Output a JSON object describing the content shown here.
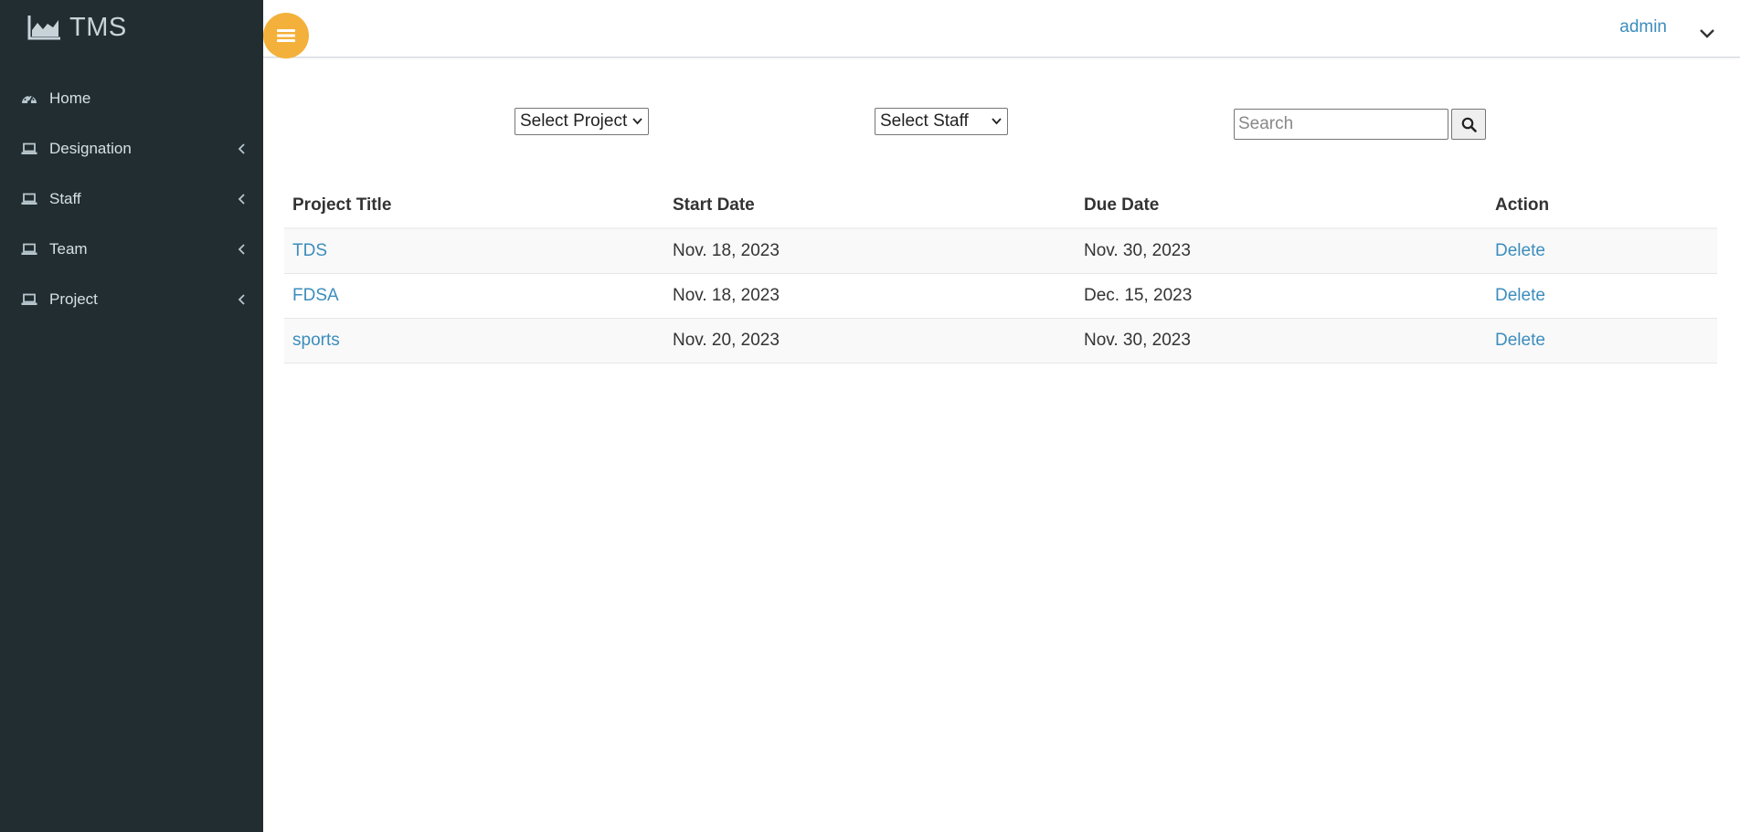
{
  "app": {
    "brand": "TMS"
  },
  "sidebar": {
    "items": [
      {
        "label": "Home",
        "icon": "dashboard-icon",
        "has_submenu": false
      },
      {
        "label": "Designation",
        "icon": "laptop-icon",
        "has_submenu": true
      },
      {
        "label": "Staff",
        "icon": "laptop-icon",
        "has_submenu": true
      },
      {
        "label": "Team",
        "icon": "laptop-icon",
        "has_submenu": true
      },
      {
        "label": "Project",
        "icon": "laptop-icon",
        "has_submenu": true
      }
    ]
  },
  "header": {
    "user": "admin",
    "toggle_icon": "bars-icon",
    "toggle_color": "#f3b13b"
  },
  "filters": {
    "project_select": "Select Project",
    "staff_select": "Select Staff",
    "search_placeholder": "Search",
    "search_value": ""
  },
  "table": {
    "headers": [
      "Project Title",
      "Start Date",
      "Due Date",
      "Action"
    ],
    "rows": [
      {
        "title": "TDS",
        "start": "Nov. 18, 2023",
        "due": "Nov. 30, 2023",
        "action": "Delete"
      },
      {
        "title": "FDSA",
        "start": "Nov. 18, 2023",
        "due": "Dec. 15, 2023",
        "action": "Delete"
      },
      {
        "title": "sports",
        "start": "Nov. 20, 2023",
        "due": "Nov. 30, 2023",
        "action": "Delete"
      }
    ]
  },
  "colors": {
    "sidebar_bg": "#222d32",
    "link": "#3c8dbc",
    "accent": "#f3b13b"
  }
}
